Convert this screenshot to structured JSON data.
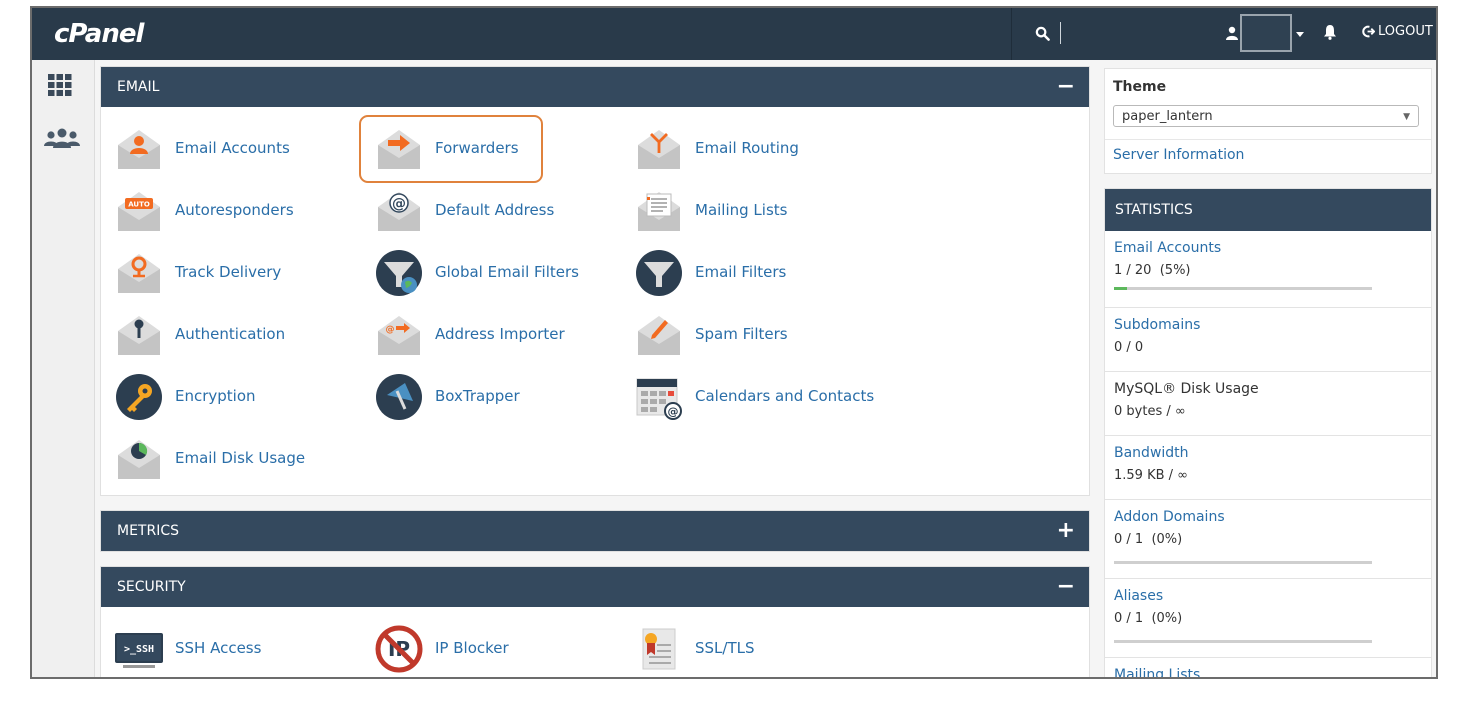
{
  "header": {
    "logo": "cPanel",
    "logout_label": "LOGOUT"
  },
  "panels": {
    "email": {
      "title": "EMAIL",
      "toggle": "−",
      "items": [
        {
          "label": "Email Accounts"
        },
        {
          "label": "Forwarders"
        },
        {
          "label": "Email Routing"
        },
        {
          "label": "Autoresponders"
        },
        {
          "label": "Default Address"
        },
        {
          "label": "Mailing Lists"
        },
        {
          "label": "Track Delivery"
        },
        {
          "label": "Global Email Filters"
        },
        {
          "label": "Email Filters"
        },
        {
          "label": "Authentication"
        },
        {
          "label": "Address Importer"
        },
        {
          "label": "Spam Filters"
        },
        {
          "label": "Encryption"
        },
        {
          "label": "BoxTrapper"
        },
        {
          "label": "Calendars and Contacts"
        },
        {
          "label": "Email Disk Usage"
        }
      ]
    },
    "metrics": {
      "title": "METRICS",
      "toggle": "+"
    },
    "security": {
      "title": "SECURITY",
      "toggle": "−",
      "items": [
        {
          "label": "SSH Access",
          "icon_text": ">_SSH"
        },
        {
          "label": "IP Blocker"
        },
        {
          "label": "SSL/TLS"
        }
      ]
    }
  },
  "sidebar": {
    "theme_title": "Theme",
    "theme_value": "paper_lantern",
    "server_info": "Server Information",
    "stats_title": "STATISTICS",
    "stats": [
      {
        "name": "Email Accounts",
        "value": "1 / 20  (5%)",
        "percent": 5
      },
      {
        "name": "Subdomains",
        "value": "0 / 0"
      },
      {
        "name": "MySQL® Disk Usage",
        "value": "0 bytes / ∞"
      },
      {
        "name": "Bandwidth",
        "value": "1.59 KB / ∞"
      },
      {
        "name": "Addon Domains",
        "value": "0 / 1  (0%)",
        "percent": 0
      },
      {
        "name": "Aliases",
        "value": "0 / 1  (0%)",
        "percent": 0
      },
      {
        "name": "Mailing Lists",
        "value": ""
      }
    ]
  },
  "colors": {
    "topbar": "#293a4a",
    "panel_header": "#34495e",
    "link": "#2a6ea8",
    "highlight": "#e0823c",
    "accent_orange": "#f26b21"
  }
}
